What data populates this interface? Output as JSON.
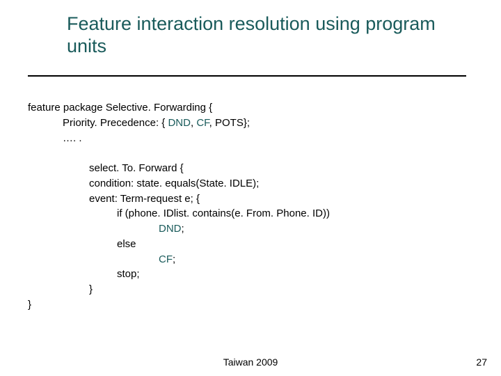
{
  "title": "Feature interaction resolution using program units",
  "code": {
    "l1_pre": "feature package Selective. Forwarding {",
    "l2_a": "Priority. Precedence: { ",
    "l2_dnd": "DND",
    "l2_sep1": ", ",
    "l2_cf": "CF",
    "l2_sep2": ", POTS};",
    "l3": "…. .",
    "l5": "select. To. Forward {",
    "l6": "condition: state. equals(State. IDLE);",
    "l7": "event: Term-request e; {",
    "l8": "if (phone. IDlist. contains(e. From. Phone. ID))",
    "l9": "DND",
    "l9_semi": ";",
    "l10": "else",
    "l11": "CF",
    "l11_semi": ";",
    "l12": "stop;",
    "l13": "}",
    "l14": "}"
  },
  "footer": "Taiwan 2009",
  "page_number": "27"
}
